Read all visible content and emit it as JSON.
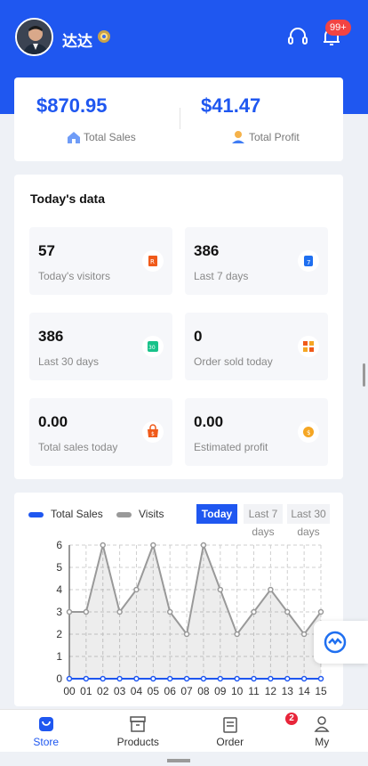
{
  "header": {
    "username": "达达",
    "notification_count": "99+",
    "colors": {
      "primary": "#1f57f0",
      "badge": "#f24343"
    }
  },
  "sales": {
    "total_sales_value": "$870.95",
    "total_sales_label": "Total Sales",
    "total_profit_value": "$41.47",
    "total_profit_label": "Total Profit"
  },
  "today": {
    "title": "Today's data",
    "stats": [
      {
        "value": "57",
        "label": "Today's visitors",
        "icon": "visitors-icon"
      },
      {
        "value": "386",
        "label": "Last 7 days",
        "icon": "calendar-7-icon"
      },
      {
        "value": "386",
        "label": "Last 30 days",
        "icon": "calendar-30-icon"
      },
      {
        "value": "0",
        "label": "Order sold today",
        "icon": "grid-order-icon"
      },
      {
        "value": "0.00",
        "label": "Total sales today",
        "icon": "shopping-bag-icon"
      },
      {
        "value": "0.00",
        "label": "Estimated profit",
        "icon": "coin-icon"
      }
    ]
  },
  "chart": {
    "legend_sales": "Total Sales",
    "legend_visits": "Visits",
    "period_today": "Today",
    "period_7_line1": "Last 7",
    "period_7_line2": "days",
    "period_30_line1": "Last 30",
    "period_30_line2": "days"
  },
  "chart_data": {
    "type": "line",
    "x": [
      "00",
      "01",
      "02",
      "03",
      "04",
      "05",
      "06",
      "07",
      "08",
      "09",
      "10",
      "11",
      "12",
      "13",
      "14",
      "15"
    ],
    "series": [
      {
        "name": "Total Sales",
        "values": [
          0,
          0,
          0,
          0,
          0,
          0,
          0,
          0,
          0,
          0,
          0,
          0,
          0,
          0,
          0,
          0
        ],
        "color": "#1f57f0"
      },
      {
        "name": "Visits",
        "values": [
          3,
          3,
          6,
          3,
          4,
          6,
          3,
          2,
          6,
          4,
          2,
          3,
          4,
          3,
          2,
          3
        ],
        "color": "#999999"
      }
    ],
    "ylim": [
      0,
      6
    ],
    "yticks": [
      "0",
      "1",
      "2",
      "3",
      "4",
      "5",
      "6"
    ],
    "grid": true
  },
  "tabbar": {
    "tabs": [
      {
        "label": "Store",
        "icon": "store-icon"
      },
      {
        "label": "Products",
        "icon": "box-icon"
      },
      {
        "label": "Order",
        "icon": "clipboard-icon"
      },
      {
        "label": "My",
        "icon": "user-icon"
      }
    ],
    "order_badge": "2"
  }
}
